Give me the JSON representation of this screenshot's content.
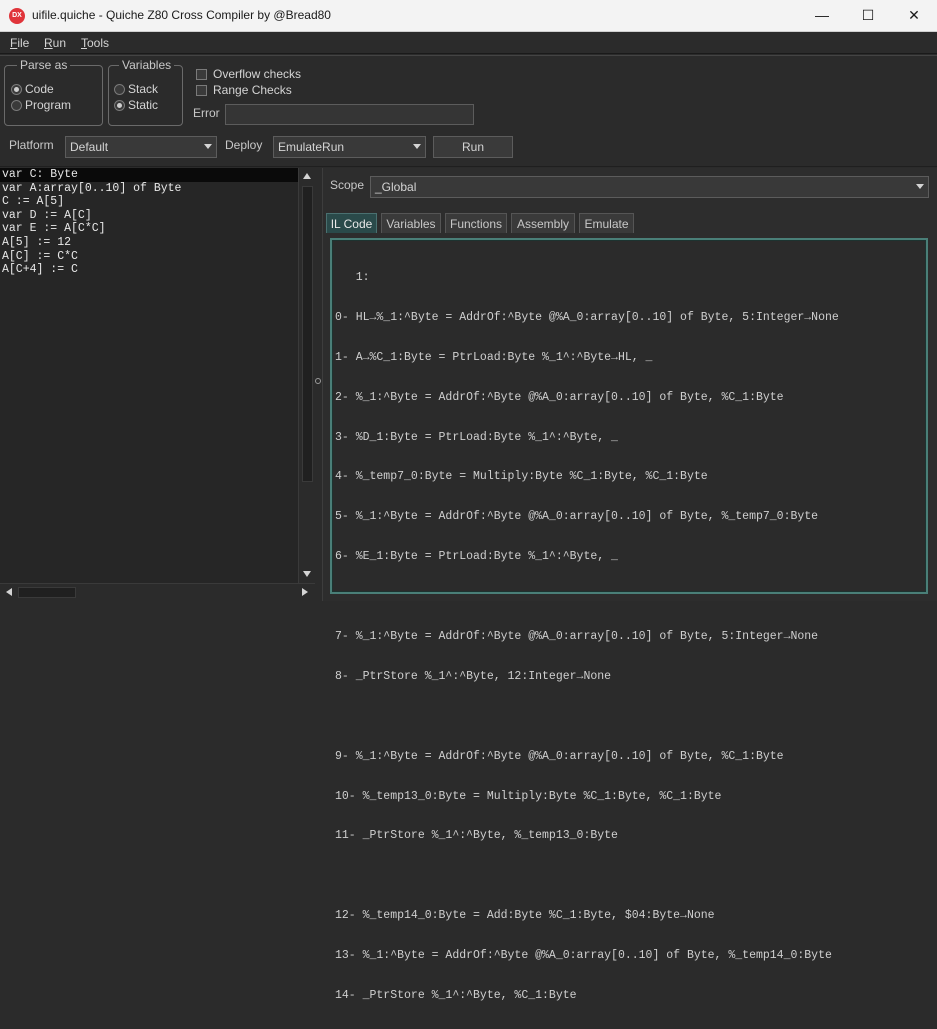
{
  "window": {
    "title": "uifile.quiche - Quiche Z80 Cross Compiler by @Bread80",
    "icon_text": "DX",
    "minimize_glyph": "—",
    "maximize_glyph": "☐",
    "close_glyph": "✕"
  },
  "menu": [
    {
      "label": "File",
      "mnemonic": "F",
      "rest": "ile"
    },
    {
      "label": "Run",
      "mnemonic": "R",
      "rest": "un"
    },
    {
      "label": "Tools",
      "mnemonic": "T",
      "rest": "ools"
    }
  ],
  "parse_as": {
    "legend": "Parse as",
    "options": [
      {
        "label": "Code",
        "selected": true
      },
      {
        "label": "Program",
        "selected": false
      }
    ]
  },
  "variables": {
    "legend": "Variables",
    "options": [
      {
        "label": "Stack",
        "selected": false
      },
      {
        "label": "Static",
        "selected": true
      }
    ]
  },
  "checks": [
    {
      "label": "Overflow checks",
      "checked": false
    },
    {
      "label": "Range Checks",
      "checked": false
    }
  ],
  "error": {
    "label": "Error",
    "value": ""
  },
  "platform": {
    "label": "Platform",
    "value": "Default"
  },
  "deploy": {
    "label": "Deploy",
    "value": "EmulateRun"
  },
  "run_button": "Run",
  "source_lines": [
    "var C: Byte",
    "var A:array[0..10] of Byte",
    "C := A[5]",
    "var D := A[C]",
    "var E := A[C*C]",
    "A[5] := 12",
    "A[C] := C*C",
    "A[C+4] := C"
  ],
  "scope": {
    "label": "Scope",
    "value": "_Global"
  },
  "tabs": [
    {
      "label": "IL Code",
      "active": true
    },
    {
      "label": "Variables",
      "active": false
    },
    {
      "label": "Functions",
      "active": false
    },
    {
      "label": "Assembly",
      "active": false
    },
    {
      "label": "Emulate",
      "active": false
    }
  ],
  "il_lines": [
    "   1:",
    "0- HL→%_1:^Byte = AddrOf:^Byte @%A_0:array[0..10] of Byte, 5:Integer→None",
    "1- A→%C_1:Byte = PtrLoad:Byte %_1^:^Byte→HL, _",
    "2- %_1:^Byte = AddrOf:^Byte @%A_0:array[0..10] of Byte, %C_1:Byte",
    "3- %D_1:Byte = PtrLoad:Byte %_1^:^Byte, _",
    "4- %_temp7_0:Byte = Multiply:Byte %C_1:Byte, %C_1:Byte",
    "5- %_1:^Byte = AddrOf:^Byte @%A_0:array[0..10] of Byte, %_temp7_0:Byte",
    "6- %E_1:Byte = PtrLoad:Byte %_1^:^Byte, _",
    "",
    "7- %_1:^Byte = AddrOf:^Byte @%A_0:array[0..10] of Byte, 5:Integer→None",
    "8- _PtrStore %_1^:^Byte, 12:Integer→None",
    "",
    "9- %_1:^Byte = AddrOf:^Byte @%A_0:array[0..10] of Byte, %C_1:Byte",
    "10- %_temp13_0:Byte = Multiply:Byte %C_1:Byte, %C_1:Byte",
    "11- _PtrStore %_1^:^Byte, %_temp13_0:Byte",
    "",
    "12- %_temp14_0:Byte = Add:Byte %C_1:Byte, $04:Byte→None",
    "13- %_1:^Byte = AddrOf:^Byte @%A_0:array[0..10] of Byte, %_temp14_0:Byte",
    "14- _PtrStore %_1^:^Byte, %C_1:Byte"
  ]
}
